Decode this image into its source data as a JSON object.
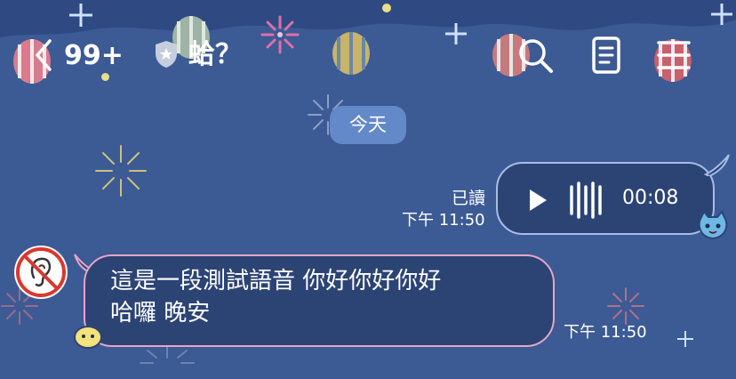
{
  "header": {
    "back_icon": "chevron-left-icon",
    "unread_count": "99+",
    "chat_title": "蛤？",
    "shield_icon": "shield-star-icon",
    "search_icon": "search-icon",
    "notes_icon": "notes-icon",
    "menu_icon": "menu-icon"
  },
  "date_divider": "今天",
  "messages": {
    "outgoing_voice": {
      "read_status": "已讀",
      "time": "下午 11:50",
      "duration": "00:08",
      "play_icon": "play-icon",
      "waveform_icon": "audio-waveform-icon"
    },
    "incoming_text": {
      "text": "這是一段測試語音 你好你好你好\n哈囉 晚安",
      "time": "下午 11:50",
      "avatar_icon": "ear-muted-icon"
    }
  },
  "colors": {
    "background": "#3c5a94",
    "bubble_fill": "#2c4474",
    "date_pill": "#6489c9",
    "outgoing_border": "#a7bde8",
    "incoming_border": "#e5a6c7"
  }
}
